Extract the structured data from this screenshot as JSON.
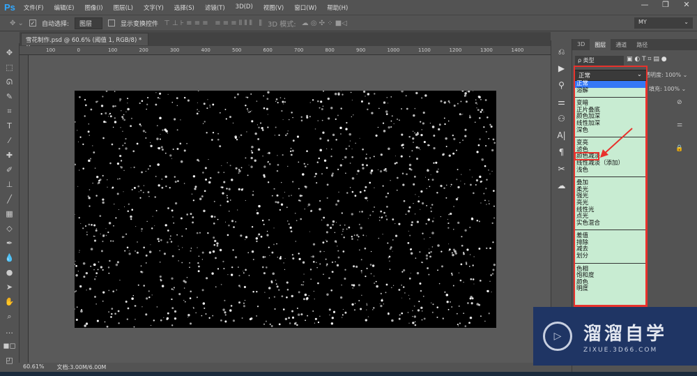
{
  "app": {
    "logo": "Ps",
    "menus": [
      "文件(F)",
      "编辑(E)",
      "图像(I)",
      "图层(L)",
      "文字(Y)",
      "选择(S)",
      "滤镜(T)",
      "3D(D)",
      "视图(V)",
      "窗口(W)",
      "帮助(H)"
    ]
  },
  "window_controls": {
    "minimize": "—",
    "restore": "❐",
    "close": "✕"
  },
  "options": {
    "auto_select_label": "自动选择:",
    "auto_select_value": "图层",
    "show_transform_label": "显示变换控件",
    "mode_3d_label": "3D 模式:",
    "workspace": "MY"
  },
  "document": {
    "tab_title": "雪花制作.psd @ 60.6% (阈值 1, RGB/8) *",
    "close": "×"
  },
  "ruler": [
    "100",
    "0",
    "100",
    "200",
    "300",
    "400",
    "500",
    "600",
    "700",
    "800",
    "900",
    "1000",
    "1100",
    "1200",
    "1300",
    "1400"
  ],
  "status": {
    "zoom": "60.61%",
    "doc_size": "文档:3.00M/6.00M"
  },
  "panel": {
    "tabs": [
      "3D",
      "图层",
      "通道",
      "路径"
    ],
    "active_tab": "图层",
    "filter": "ρ 类型",
    "opacity_label": "不透明度:",
    "opacity_value": "100%",
    "fill_label": "填充:",
    "fill_value": "100%"
  },
  "blend_mode": {
    "current": "正常",
    "groups": [
      [
        "正常",
        "溶解"
      ],
      [
        "变暗",
        "正片叠底",
        "颜色加深",
        "线性加深",
        "深色"
      ],
      [
        "变亮",
        "滤色",
        "颜色减淡",
        "线性减淡（添加）",
        "浅色"
      ],
      [
        "叠加",
        "柔光",
        "强光",
        "亮光",
        "线性光",
        "点光",
        "实色混合"
      ],
      [
        "差值",
        "排除",
        "减去",
        "划分"
      ],
      [
        "色相",
        "饱和度",
        "颜色",
        "明度"
      ]
    ],
    "highlighted": "正常",
    "annotated": "滤色"
  },
  "watermark": {
    "title": "溜溜自学",
    "url": "ZIXUE.3D66.COM"
  },
  "colors": {
    "annotation": "#e8322c",
    "dropdown_bg": "#c8ecd2",
    "highlight": "#3478f6"
  }
}
